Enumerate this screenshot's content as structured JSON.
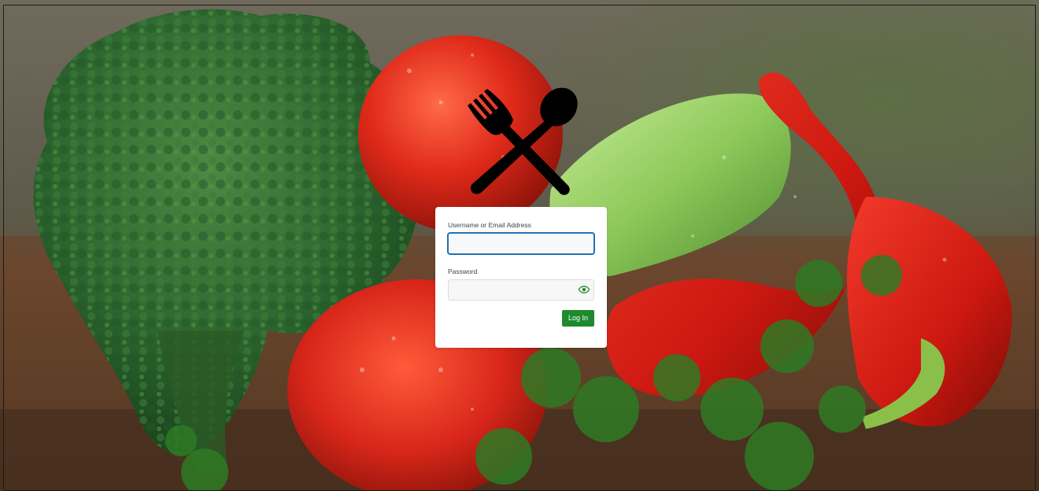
{
  "background": {
    "image_subject": "vegetables-photo",
    "colors": {
      "broccoli": "#2f6b30",
      "tomato": "#e02a1a",
      "pepper": "#d81a12",
      "cucumber": "#8ec95a",
      "parsley": "#2e7a25",
      "table": "#5a3a24"
    }
  },
  "logo": {
    "icon": "fork-spoon-crossed-icon",
    "color": "#000000"
  },
  "login_form": {
    "username_label": "Username or Email Address",
    "username_value": "",
    "password_label": "Password",
    "password_value": "",
    "password_toggle_icon": "eye-icon",
    "submit_label": "Log In",
    "colors": {
      "submit_bg": "#1e8a2e",
      "focus_border": "#2271b1",
      "eye_icon": "#1e8a2e"
    }
  }
}
